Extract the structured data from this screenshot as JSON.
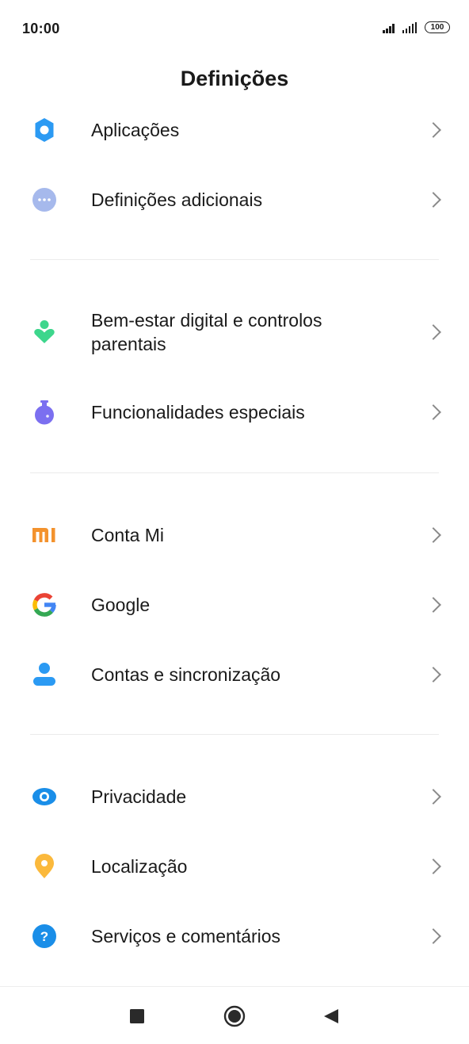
{
  "status": {
    "time": "10:00",
    "battery": "100"
  },
  "header": {
    "title": "Definições"
  },
  "settings": [
    {
      "id": "apps",
      "label": "Aplicações",
      "icon": "gear-icon",
      "color": "#2b9af3"
    },
    {
      "id": "additional",
      "label": "Definições adicionais",
      "icon": "more-dots-icon",
      "color": "#a6b9ec"
    },
    {
      "id": "wellbeing",
      "label": "Bem-estar digital e controlos parentais",
      "icon": "wellbeing-heart-icon",
      "color": "#3dd68c"
    },
    {
      "id": "special",
      "label": "Funcionalidades especiais",
      "icon": "flask-icon",
      "color": "#7b6ff0"
    },
    {
      "id": "mi-account",
      "label": "Conta Mi",
      "icon": "mi-logo-icon",
      "color": "#f3922d"
    },
    {
      "id": "google",
      "label": "Google",
      "icon": "google-g-icon",
      "color": "#4285f4"
    },
    {
      "id": "accounts",
      "label": "Contas e sincronização",
      "icon": "person-icon",
      "color": "#2b9af3"
    },
    {
      "id": "privacy",
      "label": "Privacidade",
      "icon": "eye-icon",
      "color": "#1a8ee8"
    },
    {
      "id": "location",
      "label": "Localização",
      "icon": "location-pin-icon",
      "color": "#fbb93c"
    },
    {
      "id": "services",
      "label": "Serviços e comentários",
      "icon": "help-icon",
      "color": "#1a8ee8"
    }
  ],
  "navbar": {
    "recents": "recents-icon",
    "home": "home-icon",
    "back": "back-icon"
  }
}
